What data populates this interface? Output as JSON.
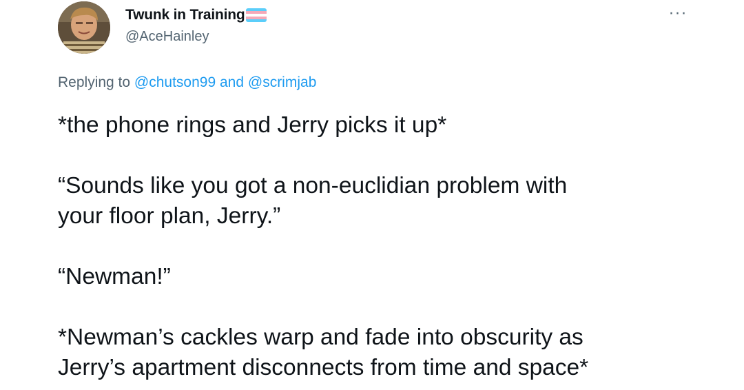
{
  "author": {
    "display_name": "Twunk in Training",
    "handle": "@AceHainley",
    "avatar_icon": "user-avatar-photo",
    "badge_icon": "trans-flag-emoji"
  },
  "menu": {
    "more_label": "···"
  },
  "reply_context": {
    "prefix": "Replying to",
    "user1": "@chutson99",
    "joiner": "and",
    "user2": "@scrimjab"
  },
  "tweet": {
    "line1": "*the phone rings and Jerry picks it up*",
    "line2": "“Sounds like you got a non-euclidian problem with",
    "line3": "your floor plan, Jerry.”",
    "line4": "“Newman!”",
    "line5": "*Newman’s cackles warp and fade into obscurity as",
    "line6": "Jerry’s apartment disconnects from time and space*"
  },
  "colors": {
    "text": "#0f1419",
    "secondary": "#536471",
    "link": "#1d9bf0",
    "flag_blue": "#5bcefa",
    "flag_pink": "#f5a9b8",
    "flag_white": "#ffffff"
  }
}
